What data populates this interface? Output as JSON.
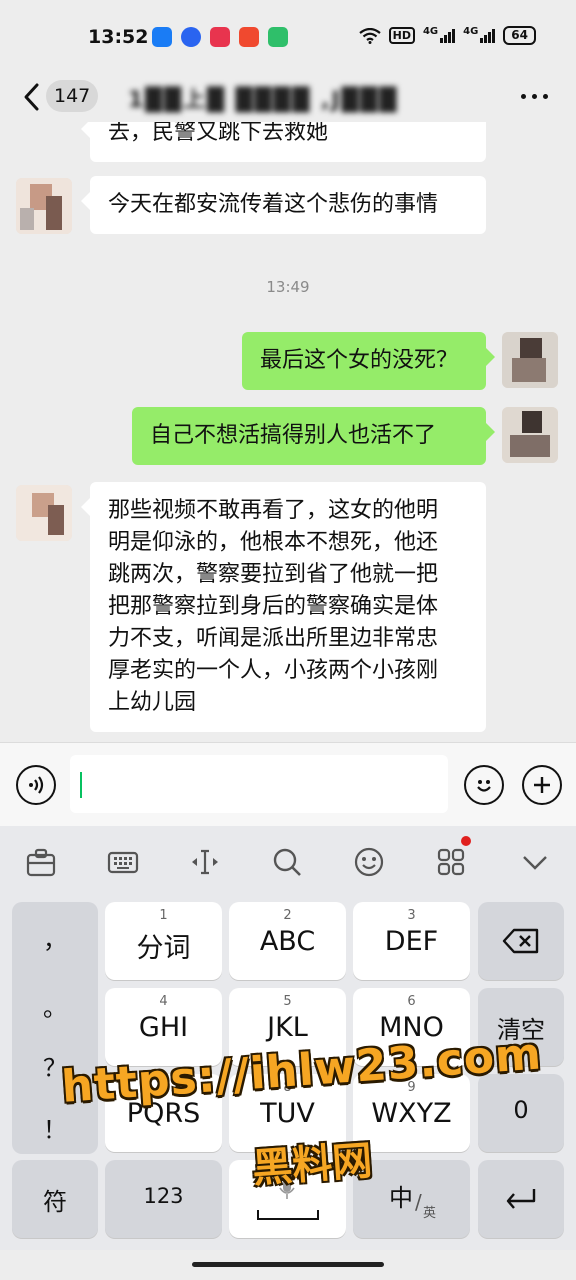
{
  "status_bar": {
    "time": "13:52",
    "hd_label": "HD",
    "net1": "4G",
    "net2": "4G",
    "battery": "64",
    "app_icon_colors": [
      "#1a7cf5",
      "#2a64f0",
      "#e8344e",
      "#f0492f",
      "#2fbf6a"
    ]
  },
  "title_bar": {
    "unread_count": "147",
    "chat_title": "1██上█ ████ ,J███"
  },
  "messages": [
    {
      "side": "in",
      "text": "去，民警又跳下去救她"
    },
    {
      "side": "in",
      "text": "今天在都安流传着这个悲伤的事情"
    },
    {
      "side": "time",
      "text": "13:49"
    },
    {
      "side": "out",
      "text": "最后这个女的没死？"
    },
    {
      "side": "out",
      "text": "自己不想活搞得别人也活不了"
    },
    {
      "side": "in",
      "lines": [
        "那些视频不敢再看了，这女的他明",
        "明是仰泳的，他根本不想死，他还",
        "跳两次，警察要拉到省了他就一把",
        "把那警察拉到身后的警察确实是体",
        "力不支，听闻是派出所里边非常忠",
        "厚老实的一个人，小孩两个小孩刚",
        "上幼儿园"
      ]
    }
  ],
  "input": {
    "value": ""
  },
  "keyboard": {
    "punct": [
      "，",
      "。",
      "？",
      "！"
    ],
    "keys": [
      {
        "num": "1",
        "label": "分词"
      },
      {
        "num": "2",
        "label": "ABC"
      },
      {
        "num": "3",
        "label": "DEF"
      },
      {
        "num": "4",
        "label": "GHI"
      },
      {
        "num": "5",
        "label": "JKL"
      },
      {
        "num": "6",
        "label": "MNO"
      },
      {
        "num": "7",
        "label": "PQRS"
      },
      {
        "num": "8",
        "label": "TUV"
      },
      {
        "num": "9",
        "label": "WXYZ"
      }
    ],
    "clear": "清空",
    "zero": "0",
    "symbol": "符",
    "num_mode": "123",
    "lang_main": "中",
    "lang_sub": "英"
  },
  "watermark": {
    "url": "https://ihlw23.com",
    "name": "黑料网"
  }
}
